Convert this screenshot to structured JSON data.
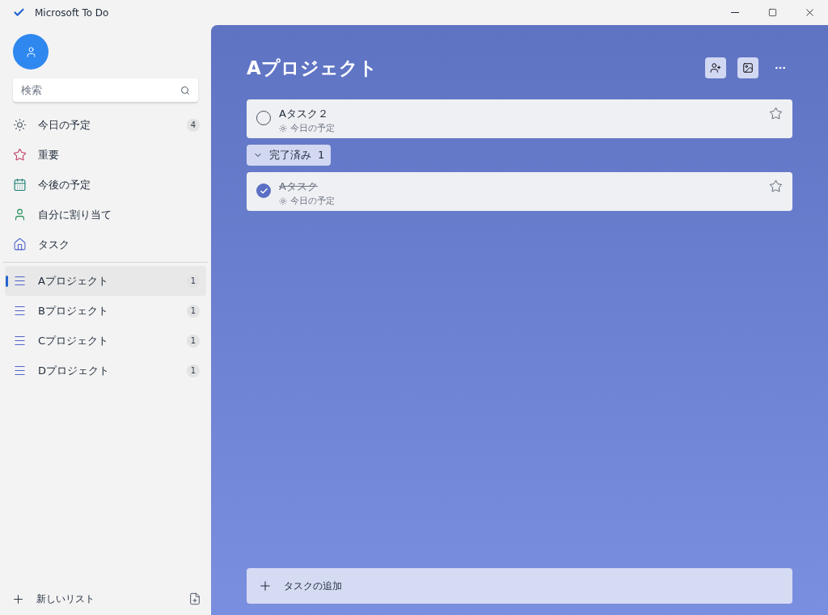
{
  "window": {
    "title": "Microsoft To Do"
  },
  "search": {
    "placeholder": "検索"
  },
  "smart_lists": [
    {
      "kind": "sun",
      "label": "今日の予定",
      "count": "4"
    },
    {
      "kind": "star",
      "label": "重要"
    },
    {
      "kind": "calendar",
      "label": "今後の予定"
    },
    {
      "kind": "person",
      "label": "自分に割り当て"
    },
    {
      "kind": "home",
      "label": "タスク"
    }
  ],
  "lists": [
    {
      "label": "Aプロジェクト",
      "count": "1",
      "selected": true
    },
    {
      "label": "Bプロジェクト",
      "count": "1",
      "selected": false
    },
    {
      "label": "Cプロジェクト",
      "count": "1",
      "selected": false
    },
    {
      "label": "Dプロジェクト",
      "count": "1",
      "selected": false
    }
  ],
  "new_list": {
    "label": "新しいリスト"
  },
  "main": {
    "title": "Aプロジェクト",
    "tasks": [
      {
        "title": "Aタスク２",
        "due": "今日の予定",
        "completed": false
      }
    ],
    "completed_group": {
      "label": "完了済み",
      "count": "1",
      "expanded": true
    },
    "completed_tasks": [
      {
        "title": "Aタスク",
        "due": "今日の予定",
        "completed": true
      }
    ],
    "add_task": {
      "placeholder": "タスクの追加"
    }
  }
}
